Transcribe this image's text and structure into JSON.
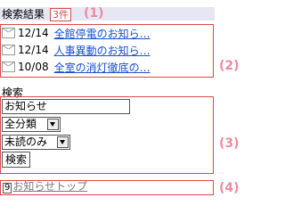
{
  "header": {
    "title": "検索結果",
    "count": "3件",
    "callout": "(1)"
  },
  "results": {
    "callout": "(2)",
    "items": [
      {
        "date": "12/14",
        "title": "全館停電のお知ら…"
      },
      {
        "date": "12/14",
        "title": "人事異動のお知ら…"
      },
      {
        "date": "10/08",
        "title": "全室の消灯徹底の…"
      }
    ]
  },
  "search": {
    "label": "検索",
    "callout": "(3)",
    "keyword_value": "お知らせ",
    "category_selected": "全分類",
    "status_selected": "未読のみ",
    "button_label": "検索"
  },
  "footer": {
    "callout": "(4)",
    "access_key": "9",
    "link_text": "お知らせトップ"
  }
}
